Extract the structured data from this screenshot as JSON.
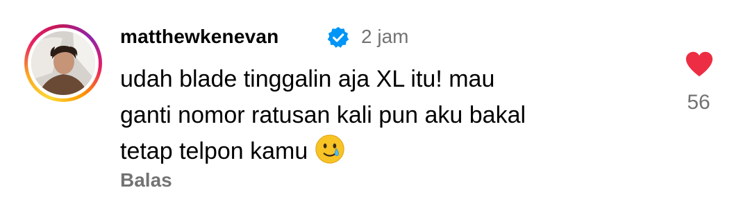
{
  "comment": {
    "username": "matthewkenevan",
    "verified": true,
    "time": "2 jam",
    "text": "udah blade tinggalin aja XL itu! mau\nganti nomor ratusan kali pun aku bakal\ntetap telpon kamu",
    "emoji": "smiling-face-with-tear",
    "reply_label": "Balas",
    "like_count": "56",
    "liked": true
  },
  "colors": {
    "like": "#ed2d43",
    "verified": "#0095f6",
    "muted": "#737373"
  }
}
